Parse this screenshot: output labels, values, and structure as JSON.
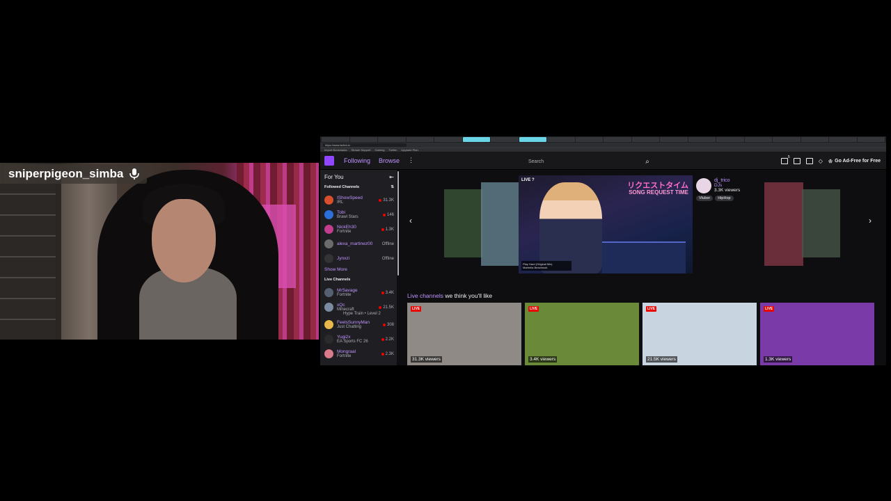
{
  "webcam": {
    "streamer_name": "sniperpigeon_simba"
  },
  "browser": {
    "url": "https://www.twitch.tv",
    "bookmarks": [
      "Import Bookmarks",
      "Stream Support",
      "Gaming",
      "Twitter",
      "Upgrade Plan"
    ]
  },
  "nav": {
    "following": "Following",
    "browse": "Browse",
    "search_placeholder": "Search",
    "notification_count": "5",
    "ad_free": "Go Ad-Free for Free"
  },
  "sidebar": {
    "for_you": "For You",
    "followed_channels": "Followed Channels",
    "followed": [
      {
        "name": "IShowSpeed",
        "category": "IRL",
        "viewers": "31.3K",
        "color": "#d94f2b"
      },
      {
        "name": "Tobi",
        "category": "Brawl Stars",
        "viewers": "146",
        "color": "#2b6fd9"
      },
      {
        "name": "NickEh30",
        "category": "Fortnite",
        "viewers": "1.3K",
        "color": "#c23d8d"
      },
      {
        "name": "alexa_martinez00",
        "category": "",
        "viewers": "Offline",
        "color": "#6b6b6b"
      },
      {
        "name": "Jynxzi",
        "category": "",
        "viewers": "Offline",
        "color": "#333333"
      }
    ],
    "show_more": "Show More",
    "live_channels": "Live Channels",
    "live": [
      {
        "name": "MrSavage",
        "category": "Fortnite",
        "viewers": "3.4K",
        "color": "#556070"
      },
      {
        "name": "xQc",
        "category": "Minecraft",
        "viewers": "21.5K",
        "color": "#7a8aa0",
        "extra": "Hype Train • Level 2"
      },
      {
        "name": "FeelsSunnyMan",
        "category": "Just Chatting",
        "viewers": "308",
        "color": "#e8b84a"
      },
      {
        "name": "Yugi2x",
        "category": "EA Sports FC 26",
        "viewers": "2.2K",
        "color": "#2a2a2a"
      },
      {
        "name": "Mongraal",
        "category": "Fortnite",
        "viewers": "2.3K",
        "color": "#d97b8a"
      }
    ]
  },
  "featured": {
    "live_label": "LIVE ?",
    "overlay_title": "リクエストタイム",
    "overlay_subtitle": "SONG REQUEST TIME",
    "now_playing": "Play Hard (Original Mix)",
    "now_playing_artist": "Marbella Beachrock",
    "channel": "dj_trico",
    "category": "DJs",
    "viewers": "3.3K viewers",
    "tags": [
      "Vtuber",
      "HipHop"
    ]
  },
  "live_section": {
    "highlight": "Live channels",
    "rest": " we think you'll like",
    "live_badge": "LIVE",
    "cards": [
      {
        "viewers": "31.3K viewers",
        "bg": "#8f8a85"
      },
      {
        "viewers": "3.4K viewers",
        "bg": "#6a8a3a"
      },
      {
        "viewers": "21.5K viewers",
        "bg": "#c8d4e0"
      },
      {
        "viewers": "1.3K viewers",
        "bg": "#7a3aa8"
      }
    ]
  },
  "colors": {
    "twitch_purple": "#9147ff",
    "link_purple": "#bf94ff",
    "live_red": "#eb0400"
  }
}
